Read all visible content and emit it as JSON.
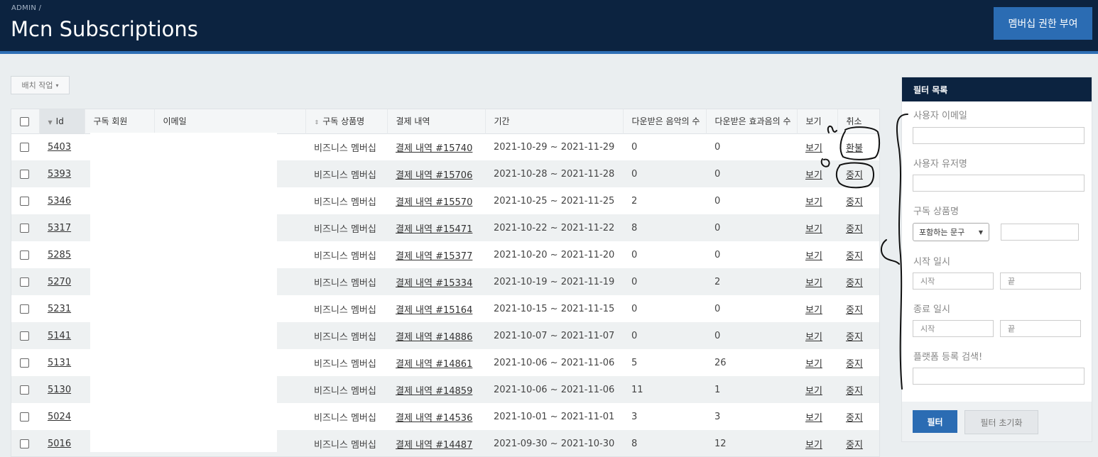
{
  "header": {
    "breadcrumb": "ADMIN /",
    "title": "Mcn Subscriptions",
    "grant_button": "멤버십 권한 부여"
  },
  "toolbar": {
    "batch_label": "배치 작업"
  },
  "table": {
    "columns": [
      "Id",
      "구독 회원",
      "이메일",
      "구독 상품명",
      "결제 내역",
      "기간",
      "다운받은 음악의 수",
      "다운받은 효과음의 수",
      "보기",
      "취소"
    ],
    "rows": [
      {
        "id": "5403",
        "product": "비즈니스 멤버십",
        "payment": "결제 내역 #15740",
        "period": "2021-10-29 ~ 2021-11-29",
        "music": "0",
        "sfx": "0",
        "view": "보기",
        "cancel": "환불"
      },
      {
        "id": "5393",
        "product": "비즈니스 멤버십",
        "payment": "결제 내역 #15706",
        "period": "2021-10-28 ~ 2021-11-28",
        "music": "0",
        "sfx": "0",
        "view": "보기",
        "cancel": "중지"
      },
      {
        "id": "5346",
        "product": "비즈니스 멤버십",
        "payment": "결제 내역 #15570",
        "period": "2021-10-25 ~ 2021-11-25",
        "music": "2",
        "sfx": "0",
        "view": "보기",
        "cancel": "중지"
      },
      {
        "id": "5317",
        "product": "비즈니스 멤버십",
        "payment": "결제 내역 #15471",
        "period": "2021-10-22 ~ 2021-11-22",
        "music": "8",
        "sfx": "0",
        "view": "보기",
        "cancel": "중지"
      },
      {
        "id": "5285",
        "product": "비즈니스 멤버십",
        "payment": "결제 내역 #15377",
        "period": "2021-10-20 ~ 2021-11-20",
        "music": "0",
        "sfx": "0",
        "view": "보기",
        "cancel": "중지"
      },
      {
        "id": "5270",
        "product": "비즈니스 멤버십",
        "payment": "결제 내역 #15334",
        "period": "2021-10-19 ~ 2021-11-19",
        "music": "0",
        "sfx": "2",
        "view": "보기",
        "cancel": "중지"
      },
      {
        "id": "5231",
        "product": "비즈니스 멤버십",
        "payment": "결제 내역 #15164",
        "period": "2021-10-15 ~ 2021-11-15",
        "music": "0",
        "sfx": "0",
        "view": "보기",
        "cancel": "중지"
      },
      {
        "id": "5141",
        "product": "비즈니스 멤버십",
        "payment": "결제 내역 #14886",
        "period": "2021-10-07 ~ 2021-11-07",
        "music": "0",
        "sfx": "0",
        "view": "보기",
        "cancel": "중지"
      },
      {
        "id": "5131",
        "product": "비즈니스 멤버십",
        "payment": "결제 내역 #14861",
        "period": "2021-10-06 ~ 2021-11-06",
        "music": "5",
        "sfx": "26",
        "view": "보기",
        "cancel": "중지"
      },
      {
        "id": "5130",
        "product": "비즈니스 멤버십",
        "payment": "결제 내역 #14859",
        "period": "2021-10-06 ~ 2021-11-06",
        "music": "11",
        "sfx": "1",
        "view": "보기",
        "cancel": "중지"
      },
      {
        "id": "5024",
        "product": "비즈니스 멤버십",
        "payment": "결제 내역 #14536",
        "period": "2021-10-01 ~ 2021-11-01",
        "music": "3",
        "sfx": "3",
        "view": "보기",
        "cancel": "중지"
      },
      {
        "id": "5016",
        "product": "비즈니스 멤버십",
        "payment": "결제 내역 #14487",
        "period": "2021-09-30 ~ 2021-10-30",
        "music": "8",
        "sfx": "12",
        "view": "보기",
        "cancel": "중지"
      }
    ]
  },
  "filters": {
    "title": "필터 목록",
    "email_label": "사용자 이메일",
    "username_label": "사용자 유저명",
    "product_label": "구독 상품명",
    "product_select": "포함하는 문구",
    "start_label": "시작 일시",
    "end_label": "종료 일시",
    "range_start_placeholder": "시작",
    "range_end_placeholder": "끝",
    "platform_label": "플랫폼 등록 검색!",
    "apply_button": "필터",
    "reset_button": "필터 초기화"
  },
  "colors": {
    "header_bg": "#0c2340",
    "accent": "#2b6cb3"
  }
}
